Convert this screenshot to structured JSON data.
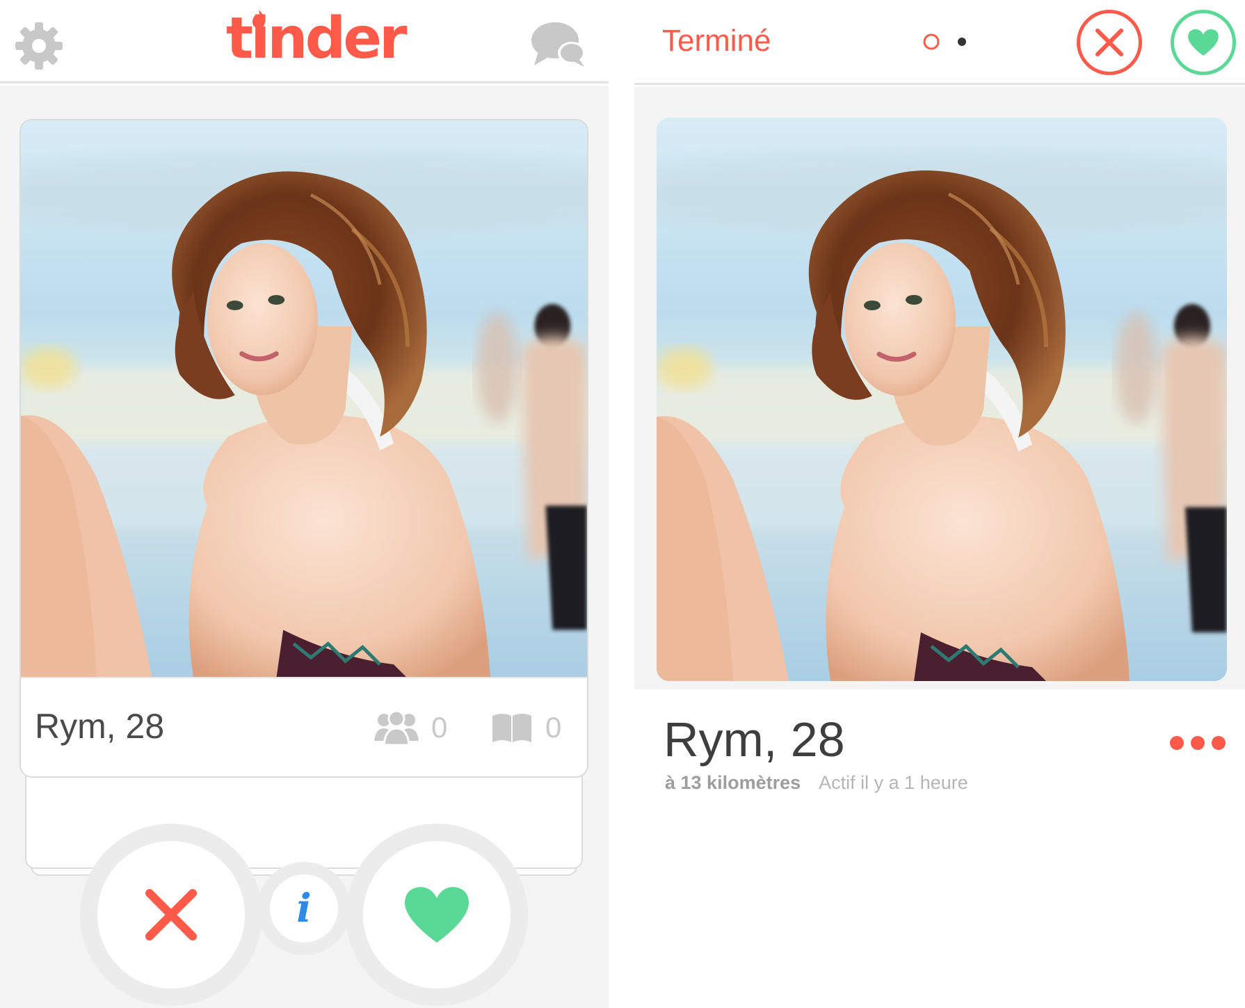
{
  "left_screen": {
    "header": {
      "settings_icon": "gear-icon",
      "logo_text": "tinder",
      "messages_icon": "chat-bubbles-icon"
    },
    "card": {
      "name_age": "Rym, 28",
      "shared_friends_icon": "people-icon",
      "shared_friends_count": "0",
      "shared_interests_icon": "book-icon",
      "shared_interests_count": "0"
    },
    "actions": {
      "nope_icon": "x-icon",
      "info_label": "i",
      "like_icon": "heart-icon"
    }
  },
  "right_screen": {
    "header": {
      "done_label": "Terminé",
      "pager_icon": "page-dots-icon",
      "nope_icon": "x-circle-icon",
      "like_icon": "heart-circle-icon"
    },
    "profile": {
      "name_age": "Rym, 28",
      "distance": "à 13 kilomètres",
      "last_active": "Actif il y a 1 heure",
      "more_icon": "more-dots-icon"
    }
  },
  "colors": {
    "brand_orange": "#fe5a49",
    "like_green": "#5ad896",
    "info_blue": "#2d8ae6",
    "icon_gray": "#c8c8c8",
    "divider": "#e3e3e3"
  }
}
